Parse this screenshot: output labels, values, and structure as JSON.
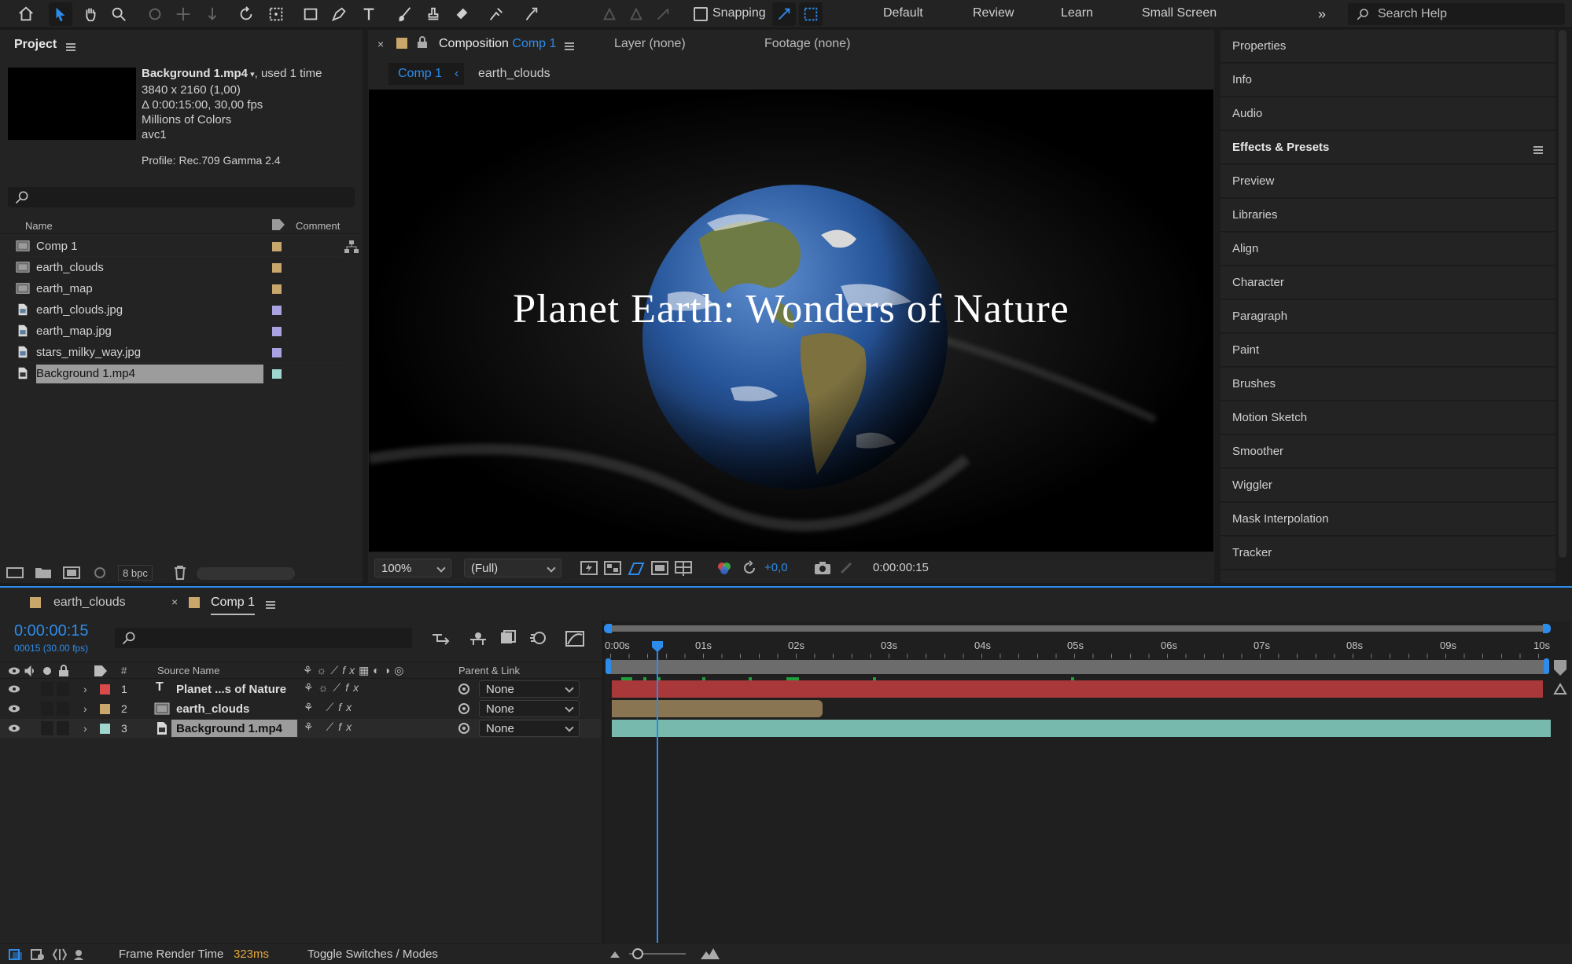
{
  "toolbar": {
    "snapping_label": "Snapping",
    "workspaces": [
      "Default",
      "Review",
      "Learn",
      "Small Screen"
    ],
    "search_placeholder": "Search Help"
  },
  "project": {
    "title": "Project",
    "footage": {
      "name": "Background 1.mp4",
      "usage": ", used 1 time",
      "resolution": "3840 x 2160 (1,00)",
      "duration": "Δ 0:00:15:00, 30,00 fps",
      "colors": "Millions of Colors",
      "codec": "avc1",
      "profile": "Profile: Rec.709 Gamma 2.4"
    },
    "columns": {
      "name": "Name",
      "comment": "Comment"
    },
    "items": [
      {
        "name": "Comp 1",
        "type": "comp",
        "color": "#c9a66b"
      },
      {
        "name": "earth_clouds",
        "type": "comp",
        "color": "#c9a66b"
      },
      {
        "name": "earth_map",
        "type": "comp",
        "color": "#c9a66b"
      },
      {
        "name": "earth_clouds.jpg",
        "type": "image",
        "color": "#a9a2e0"
      },
      {
        "name": "earth_map.jpg",
        "type": "image",
        "color": "#a9a2e0"
      },
      {
        "name": "stars_milky_way.jpg",
        "type": "image",
        "color": "#a9a2e0"
      },
      {
        "name": "Background 1.mp4",
        "type": "video",
        "color": "#9fd7cf",
        "selected": true
      }
    ],
    "bpc": "8 bpc"
  },
  "composition": {
    "tab_prefix": "Composition",
    "tab_name": "Comp 1",
    "layer_tab": "Layer (none)",
    "footage_tab": "Footage (none)",
    "breadcrumbs": [
      "Comp 1",
      "earth_clouds"
    ],
    "title_text": "Planet Earth: Wonders of Nature",
    "zoom": "100%",
    "resolution": "(Full)",
    "exposure": "+0,0",
    "timecode": "0:00:00:15"
  },
  "right_panel": {
    "items": [
      "Properties",
      "Info",
      "Audio",
      "Effects & Presets",
      "Preview",
      "Libraries",
      "Align",
      "Character",
      "Paragraph",
      "Paint",
      "Brushes",
      "Motion Sketch",
      "Smoother",
      "Wiggler",
      "Mask Interpolation",
      "Tracker"
    ]
  },
  "timeline": {
    "tabs": [
      {
        "name": "earth_clouds",
        "color": "#c9a66b"
      },
      {
        "name": "Comp 1",
        "color": "#c9a66b"
      }
    ],
    "current_time": "0:00:00:15",
    "frame_info": "00015 (30.00 fps)",
    "columns": {
      "number": "#",
      "source": "Source Name",
      "parent": "Parent & Link"
    },
    "ruler": [
      "0:00s",
      "01s",
      "02s",
      "03s",
      "04s",
      "05s",
      "06s",
      "07s",
      "08s",
      "09s",
      "10s"
    ],
    "layers": [
      {
        "num": "1",
        "name": "Planet ...s of Nature",
        "type": "text",
        "label_color": "#d94a4a",
        "parent": "None"
      },
      {
        "num": "2",
        "name": "earth_clouds",
        "type": "comp",
        "label_color": "#c9a66b",
        "parent": "None"
      },
      {
        "num": "3",
        "name": "Background 1.mp4",
        "type": "video",
        "label_color": "#9fd7cf",
        "parent": "None"
      }
    ],
    "footer": {
      "render_label": "Frame Render Time",
      "render_value": "323ms",
      "toggle_label": "Toggle Switches / Modes"
    }
  },
  "colors": {
    "accent": "#2d8ceb",
    "text_layer_bar": "#a8383a",
    "comp_layer_bar": "#8a7553",
    "video_layer_bar": "#77b9ad"
  }
}
